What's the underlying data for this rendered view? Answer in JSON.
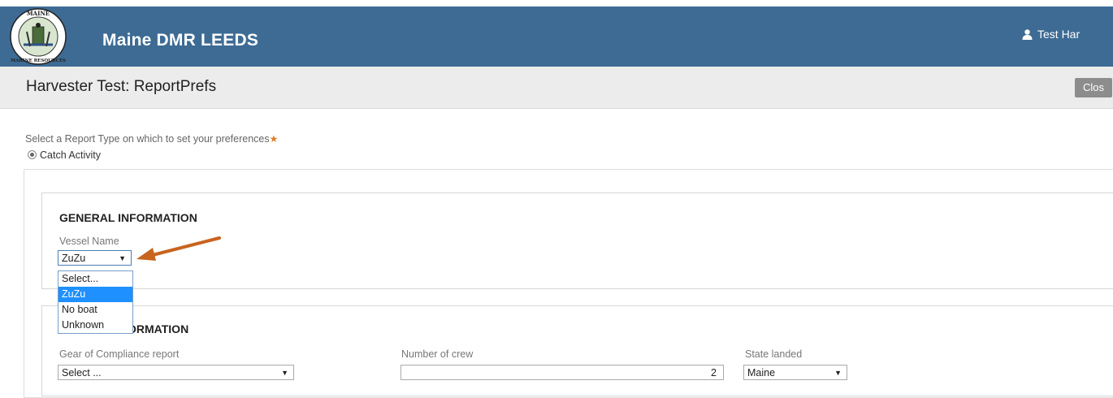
{
  "header": {
    "app_title": "Maine DMR LEEDS",
    "seal_top_text": "MAINE",
    "seal_bottom_text": "MARINE RESOURCES",
    "user_name": "Test Har",
    "brand_color": "#3d6b94"
  },
  "subheader": {
    "page_title": "Harvester Test: ReportPrefs",
    "close_label": "Clos"
  },
  "report_type": {
    "prompt": "Select a Report Type on which to set your preferences",
    "required_marker": "★",
    "option_label": "Catch Activity",
    "selected": true
  },
  "general": {
    "title": "GENERAL INFORMATION",
    "vessel_label": "Vessel Name",
    "vessel_value": "ZuZu",
    "vessel_options": [
      "Select...",
      "ZuZu",
      "No boat",
      "Unknown"
    ],
    "highlighted_option": "ZuZu"
  },
  "trip": {
    "title_visible": "ORMATION",
    "gear_label": "Gear of Compliance report",
    "gear_value": "Select ...",
    "crew_label": "Number of crew",
    "crew_value": "2",
    "state_label": "State landed",
    "state_value": "Maine"
  },
  "annotation": {
    "arrow_color": "#c8641e"
  }
}
